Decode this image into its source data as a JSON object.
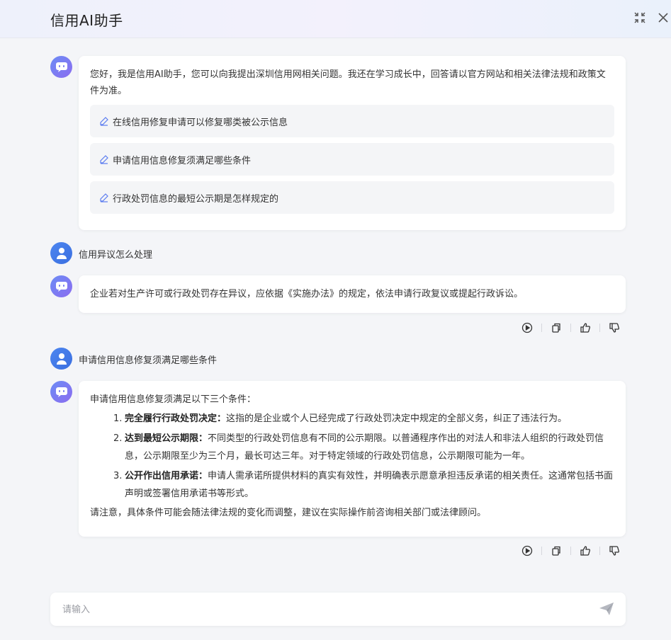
{
  "header": {
    "title": "信用AI助手"
  },
  "welcome": {
    "text": "您好，我是信用AI助手，您可以向我提出深圳信用网相关问题。我还在学习成长中，回答请以官方网站和相关法律法规和政策文件为准。",
    "suggestions": [
      "在线信用修复申请可以修复哪类被公示信息",
      "申请信用信息修复须满足哪些条件",
      "行政处罚信息的最短公示期是怎样规定的"
    ]
  },
  "conversation": [
    {
      "question": "信用异议怎么处理",
      "answer": "企业若对生产许可或行政处罚存在异议，应依据《实施办法》的规定，依法申请行政复议或提起行政诉讼。"
    },
    {
      "question": "申请信用信息修复须满足哪些条件",
      "answer_intro": "申请信用信息修复须满足以下三个条件：",
      "conditions": [
        {
          "num": "1.",
          "title": "完全履行行政处罚决定",
          "sep": "：",
          "text": "这指的是企业或个人已经完成了行政处罚决定中规定的全部义务，纠正了违法行为。"
        },
        {
          "num": "2.",
          "title": "达到最短公示期限",
          "sep": "：",
          "text": "不同类型的行政处罚信息有不同的公示期限。以普通程序作出的对法人和非法人组织的行政处罚信息，公示期限至少为三个月，最长可达三年。对于特定领域的行政处罚信息，公示期限可能为一年。"
        },
        {
          "num": "3.",
          "title": "公开作出信用承诺",
          "sep": "：",
          "text": "申请人需承诺所提供材料的真实有效性，并明确表示愿意承担违反承诺的相关责任。这通常包括书面声明或签署信用承诺书等形式。"
        }
      ],
      "answer_note": "请注意，具体条件可能会随法律法规的变化而调整，建议在实际操作前咨询相关部门或法律顾问。"
    }
  ],
  "actions": [
    "play-icon",
    "copy-icon",
    "thumbs-up-icon",
    "thumbs-down-icon"
  ],
  "input": {
    "placeholder": "请输入"
  },
  "colors": {
    "accent": "#5b7cf0",
    "bot_avatar": "#7a7cf2",
    "user_avatar": "#4479ea",
    "bubble": "#ffffff",
    "suggest_bg": "#f4f5f7"
  }
}
